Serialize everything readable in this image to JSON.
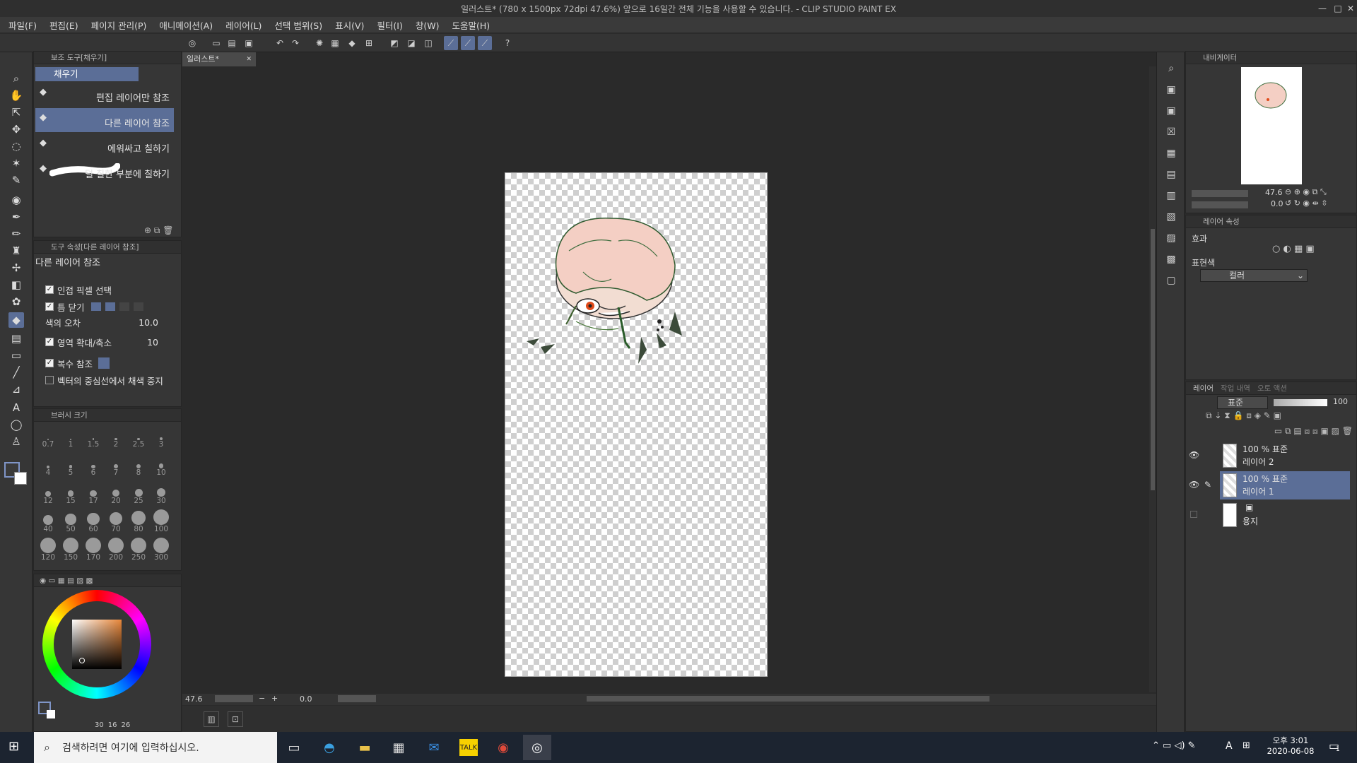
{
  "window": {
    "title": "일러스트* (780 x 1500px 72dpi 47.6%)  앞으로 16일간 전체 기능을 사용할 수 있습니다. - CLIP STUDIO PAINT EX",
    "controls": [
      "—",
      "□",
      "✕"
    ]
  },
  "menu": [
    "파일(F)",
    "편집(E)",
    "페이지 관리(P)",
    "애니메이션(A)",
    "레이어(L)",
    "선택 범위(S)",
    "표시(V)",
    "필터(I)",
    "창(W)",
    "도움말(H)"
  ],
  "subtool_panel": {
    "header": "보조 도구[채우기]",
    "group_tab": "채우기",
    "items": [
      {
        "label": "편집 레이어만 참조",
        "selected": false
      },
      {
        "label": "다른 레이어 참조",
        "selected": true
      },
      {
        "label": "에워싸고 칠하기",
        "selected": false
      },
      {
        "label": "덜 칠한 부분에 칠하기",
        "selected": false
      }
    ]
  },
  "tool_property": {
    "header": "도구 속성[다른 레이어 참조]",
    "title": "다른 레이어 참조",
    "rows": [
      {
        "label": "인접 픽셀 선택",
        "checked": true,
        "value": ""
      },
      {
        "label": "틈 닫기",
        "checked": true,
        "value": ""
      },
      {
        "label": "색의 오차",
        "checked": null,
        "value": "10.0"
      },
      {
        "label": "영역 확대/축소",
        "checked": true,
        "value": "10"
      },
      {
        "label": "복수 참조",
        "checked": true,
        "value": ""
      },
      {
        "label": "벡터의 중심선에서 채색 중지",
        "checked": false,
        "value": ""
      }
    ]
  },
  "brush_size": {
    "header": "브러시 크기",
    "sizes": [
      "0.7",
      "1",
      "1.5",
      "2",
      "2.5",
      "3",
      "4",
      "5",
      "6",
      "7",
      "8",
      "10",
      "12",
      "15",
      "17",
      "20",
      "25",
      "30",
      "40",
      "50",
      "60",
      "70",
      "80",
      "100",
      "120",
      "150",
      "170",
      "200",
      "250",
      "300"
    ]
  },
  "color_panel": {
    "values": [
      "30",
      "16",
      "26"
    ],
    "accent": "#e8873a"
  },
  "document": {
    "tab": "일러스트*",
    "zoom": "47.6",
    "rotation": "0.0"
  },
  "navigator": {
    "header": "내비게이터",
    "zoom": "47.6",
    "angle": "0.0"
  },
  "layer_property": {
    "header": "레이어 속성",
    "effect_label": "효과",
    "expression_label": "표현색",
    "expression_value": "컬러"
  },
  "layers": {
    "tabs": [
      "레이어",
      "작업 내역",
      "오토 액션"
    ],
    "blend_mode": "표준",
    "opacity": "100",
    "items": [
      {
        "top": "100 % 표준",
        "name": "레이어 2",
        "selected": false
      },
      {
        "top": "100 % 표준",
        "name": "레이어 1",
        "selected": true
      },
      {
        "top": "",
        "name": "용지",
        "selected": false
      }
    ]
  },
  "taskbar": {
    "search_placeholder": "검색하려면 여기에 입력하십시오.",
    "time": "오후 3:01",
    "date": "2020-06-08",
    "ime": "A",
    "notifications": "1"
  },
  "colors": {
    "accent": "#5b6e97",
    "panel": "#363636",
    "canvas_bg": "#2a2a2a"
  }
}
